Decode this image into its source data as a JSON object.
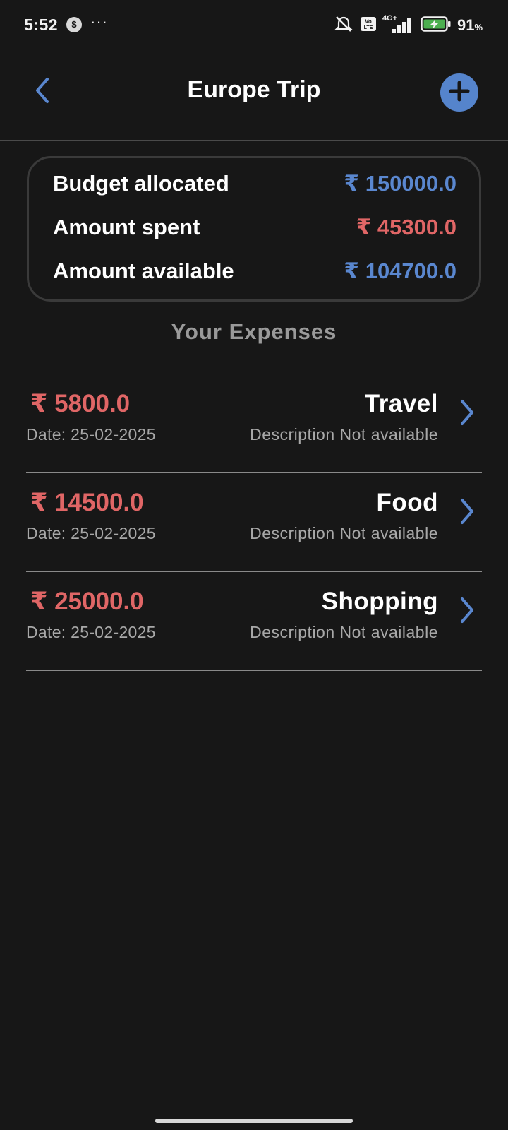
{
  "status_bar": {
    "time": "5:52",
    "app_icon_glyph": "$",
    "more_dots": "···",
    "network_label": "4G+",
    "volte_label": "Vo LTE",
    "battery_level": "91",
    "battery_unit": "%",
    "icons": [
      "silent-icon",
      "volte-icon",
      "signal-icon",
      "battery-charging-icon"
    ]
  },
  "header": {
    "title": "Europe Trip",
    "back_icon": "chevron-left-icon",
    "add_icon": "plus-icon"
  },
  "summary": {
    "currency": "₹",
    "rows": [
      {
        "label": "Budget allocated",
        "value": "₹ 150000.0"
      },
      {
        "label": "Amount spent",
        "value": "₹ 45300.0"
      },
      {
        "label": "Amount available",
        "value": "₹ 104700.0"
      }
    ]
  },
  "section_title": "Your Expenses",
  "expenses": [
    {
      "amount": "₹ 5800.0",
      "date": "Date: 25-02-2025",
      "category": "Travel",
      "description": "Description Not available"
    },
    {
      "amount": "₹ 14500.0",
      "date": "Date: 25-02-2025",
      "category": "Food",
      "description": "Description Not available"
    },
    {
      "amount": "₹ 25000.0",
      "date": "Date: 25-02-2025",
      "category": "Shopping",
      "description": "Description Not available"
    }
  ],
  "colors": {
    "background": "#171717",
    "accent_blue": "#5a87cf",
    "accent_red": "#e06666",
    "muted_text": "#a8a8a8"
  }
}
